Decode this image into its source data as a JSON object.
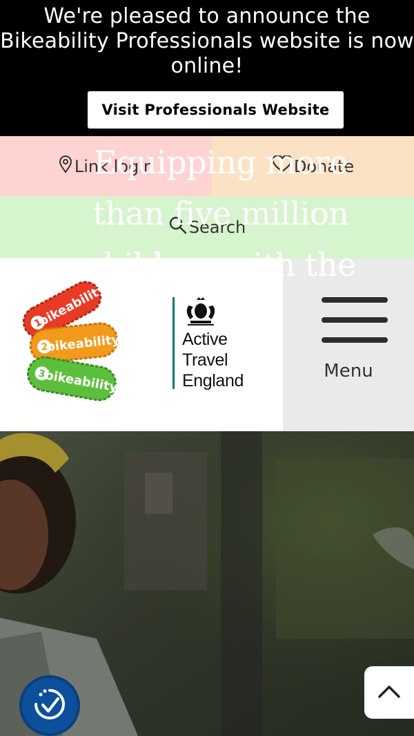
{
  "announcement": {
    "line1": "We're pleased to announce the",
    "line2": "Bikeability Professionals website is now",
    "line3": "online!",
    "button_label": "Visit Professionals Website"
  },
  "utility_nav": {
    "login_label": "Link login",
    "donate_label": "Donate",
    "search_label": "Search"
  },
  "header": {
    "bikeability_logo": {
      "levels": [
        "1",
        "2",
        "3"
      ],
      "badge_text": [
        "bikeability",
        "bikeability",
        "bikeability"
      ],
      "colors": [
        "#e83a25",
        "#f39a1c",
        "#5cbf3c"
      ]
    },
    "partner_logo": {
      "line1": "Active",
      "line2": "Travel",
      "line3": "England",
      "accent": "#0c7a6e"
    },
    "menu_label": "Menu"
  },
  "hero": {
    "heading_line1": "Equipping more",
    "heading_line2": "than five million",
    "heading_line3": "children with the"
  },
  "colors": {
    "announcement_bg": "#000000",
    "login_bg": "#fdd4d2",
    "donate_bg": "#fce2c4",
    "search_bg": "#d6f4cd",
    "menu_bg": "#eaeaea",
    "accessibility_button": "#0c4f9a"
  },
  "icons": {
    "login": "map-pin-icon",
    "donate": "heart-icon",
    "search": "search-icon",
    "menu": "hamburger-icon",
    "accessibility": "accessibility-icon",
    "scroll_top": "chevron-up-icon"
  }
}
